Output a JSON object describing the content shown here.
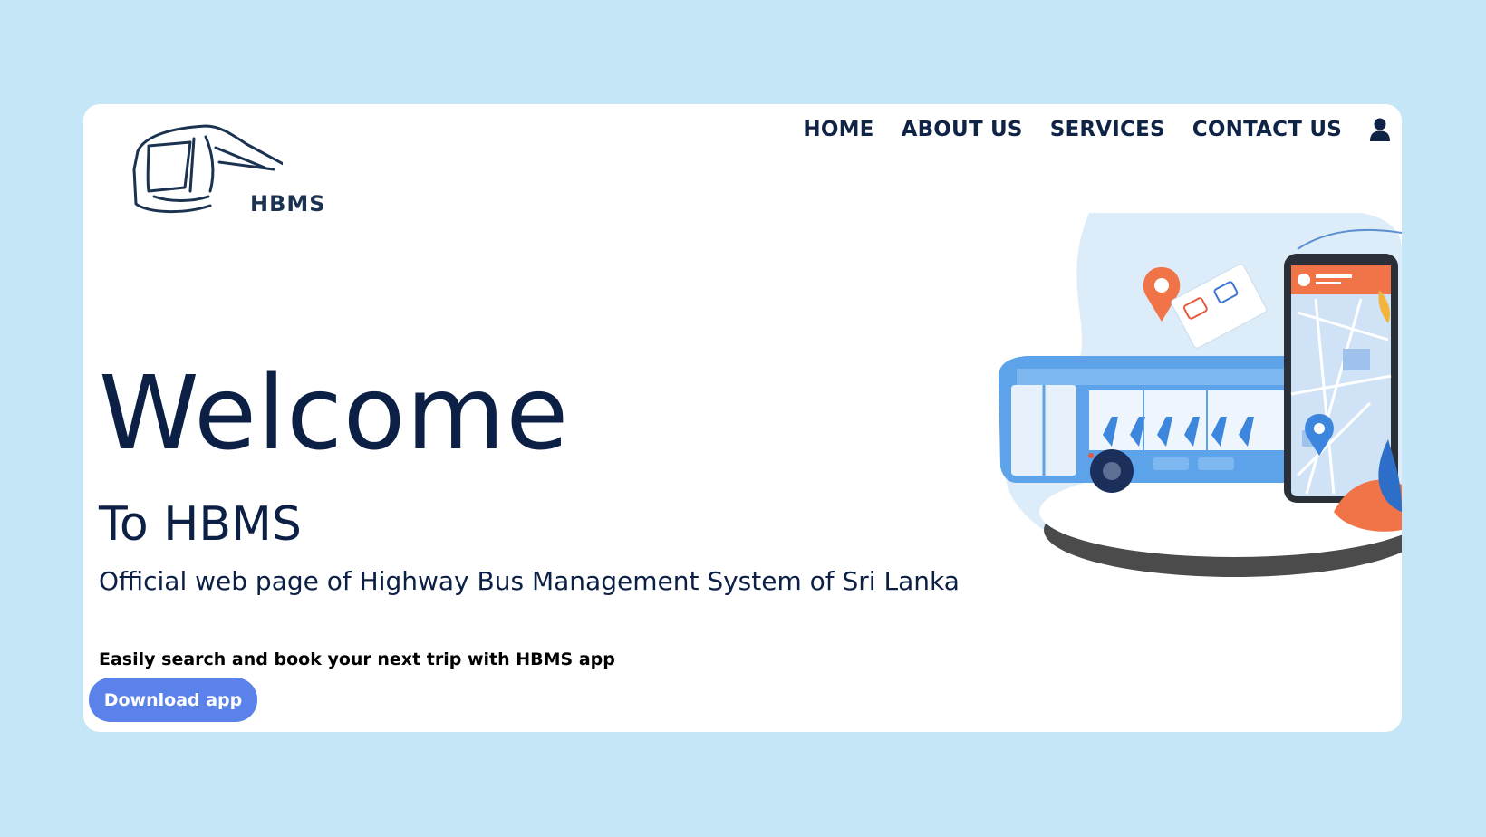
{
  "brand": {
    "logo_text": "HBMS",
    "primary_color": "#0c1f45",
    "accent_color": "#5b82ea",
    "background_color": "#c4e6f6"
  },
  "nav": {
    "items": [
      {
        "label": "HOME"
      },
      {
        "label": "ABOUT US"
      },
      {
        "label": "SERVICES"
      },
      {
        "label": "CONTACT US"
      }
    ],
    "user_icon": "user-icon"
  },
  "hero": {
    "title": "Welcome",
    "subtitle": "To HBMS",
    "description": "Official web page of Highway Bus Management System of Sri Lanka",
    "promo": "Easily search and book your next trip with HBMS app",
    "cta_label": "Download app",
    "illustration": "bus-and-phone-map-illustration"
  }
}
